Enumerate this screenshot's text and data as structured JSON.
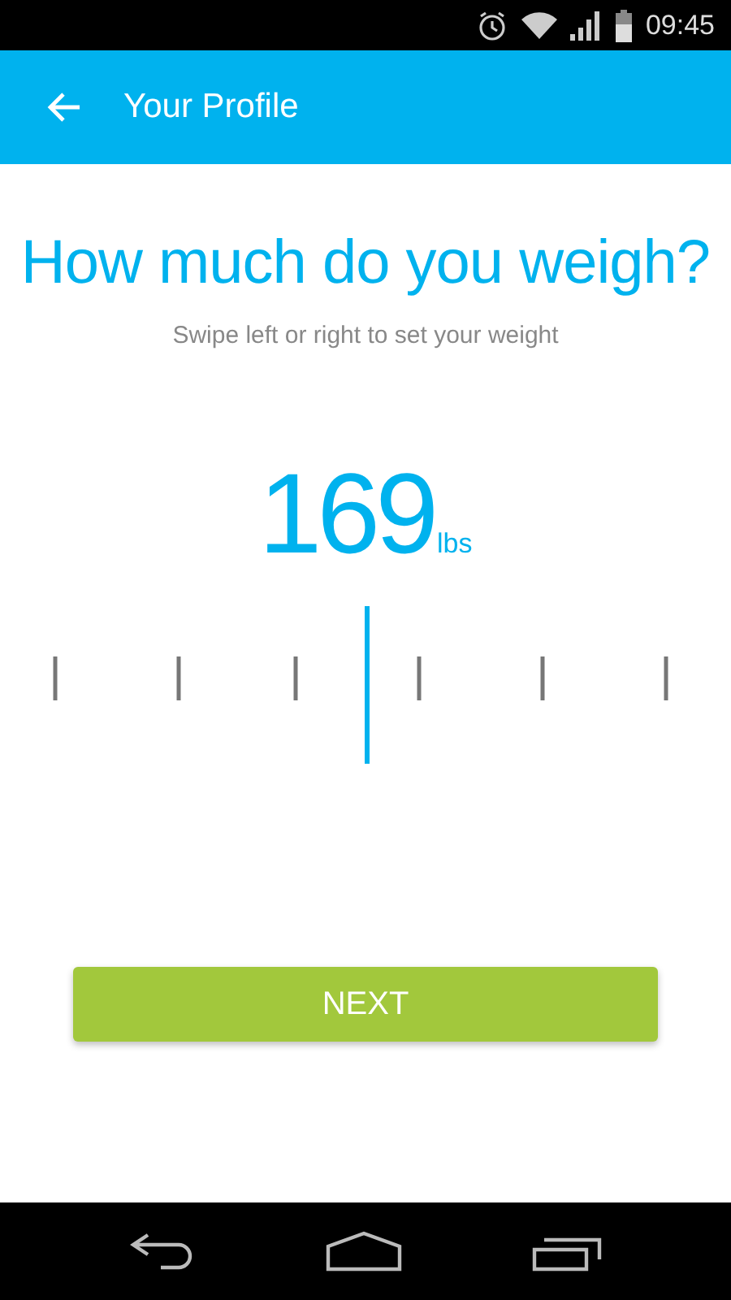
{
  "status_bar": {
    "time": "09:45"
  },
  "app_bar": {
    "title": "Your Profile"
  },
  "question": {
    "title": "How much do you weigh?",
    "hint": "Swipe left or right to set your weight"
  },
  "weight": {
    "value": "169",
    "unit": "lbs"
  },
  "button": {
    "label": "NEXT"
  }
}
